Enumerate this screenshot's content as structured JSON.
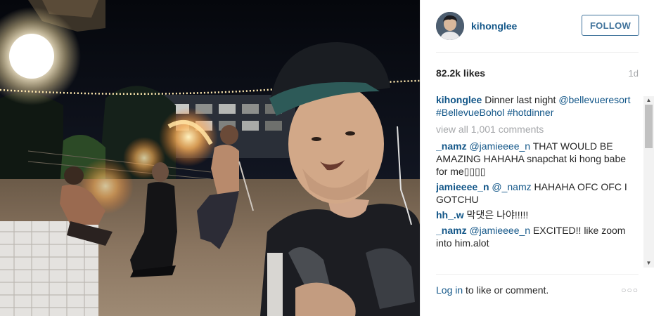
{
  "post": {
    "username": "kihonglee",
    "follow_label": "FOLLOW",
    "likes": "82.2k likes",
    "time": "1d"
  },
  "caption": {
    "user": "kihonglee",
    "text": " Dinner last night ",
    "tags": [
      "@bellevueresort",
      "#BellevueBohol",
      "#hotdinner"
    ]
  },
  "view_all": "view all 1,001 comments",
  "comments": [
    {
      "user": "_namz",
      "mention": "@jamieeee_n",
      "text": " THAT WOULD BE AMAZING HAHAHA snapchat ki hong babe for me▯▯▯▯"
    },
    {
      "user": "jamieeee_n",
      "mention": "@_namz",
      "text": " HAHAHA OFC OFC I GOTCHU"
    },
    {
      "user": "hh_.w",
      "mention": "",
      "text": " 막댓은 나야!!!!!"
    },
    {
      "user": "_namz",
      "mention": "@jamieeee_n",
      "text": " EXCITED!! like zoom into him.alot"
    }
  ],
  "footer": {
    "login": "Log in",
    "rest": " to like or comment.",
    "more_icon": "more-dots-icon"
  },
  "scrollbar": {
    "up_glyph": "▲",
    "down_glyph": "▼"
  },
  "colors": {
    "link_blue": "#125688",
    "follow_blue": "#3f729b",
    "muted": "#a5a7aa"
  }
}
